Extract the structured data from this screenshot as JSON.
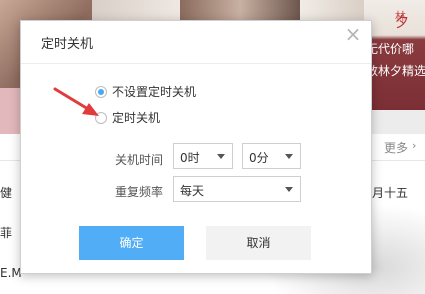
{
  "background": {
    "banner_tag": "林",
    "banner_lines": [
      "夕",
      "无代价哪",
      "数林夕精选"
    ],
    "more_link": "更多",
    "left_text_lines": [
      "健",
      "菲",
      "E.M"
    ],
    "right_text": "月十五"
  },
  "dialog": {
    "title": "定时关机",
    "options": [
      {
        "label": "不设置定时关机",
        "checked": true
      },
      {
        "label": "定时关机",
        "checked": false
      }
    ],
    "shutdown_time": {
      "label": "关机时间",
      "hour": "0时",
      "minute": "0分"
    },
    "repeat": {
      "label": "重复频率",
      "value": "每天"
    },
    "ok_label": "确定",
    "cancel_label": "取消"
  },
  "colors": {
    "accent": "#51adf6",
    "annotation_arrow": "#e23b3b"
  }
}
